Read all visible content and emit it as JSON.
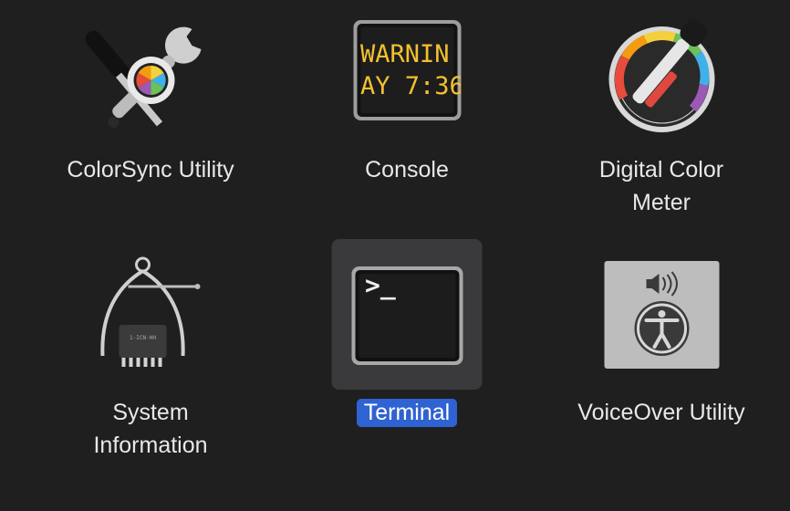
{
  "apps": [
    {
      "name": "ColorSync Utility",
      "label": "ColorSync Utility",
      "icon": "colorsync-icon",
      "selected": false
    },
    {
      "name": "Console",
      "label": "Console",
      "icon": "console-icon",
      "selected": false,
      "screen_lines": [
        "WARNIN",
        "AY 7:36"
      ]
    },
    {
      "name": "Digital Color Meter",
      "label_lines": [
        "Digital Color",
        "Meter"
      ],
      "icon": "color-meter-icon",
      "selected": false
    },
    {
      "name": "System Information",
      "label_lines": [
        "System",
        "Information"
      ],
      "icon": "system-information-icon",
      "selected": false
    },
    {
      "name": "Terminal",
      "label": "Terminal",
      "icon": "terminal-icon",
      "selected": true,
      "prompt": ">_"
    },
    {
      "name": "VoiceOver Utility",
      "label": "VoiceOver Utility",
      "icon": "voiceover-icon",
      "selected": false
    }
  ],
  "colors": {
    "background": "#1f1f1f",
    "selection_highlight": "#2f62d2",
    "selected_icon_background": "#3a3a3c",
    "console_text": "#f2c12e"
  }
}
